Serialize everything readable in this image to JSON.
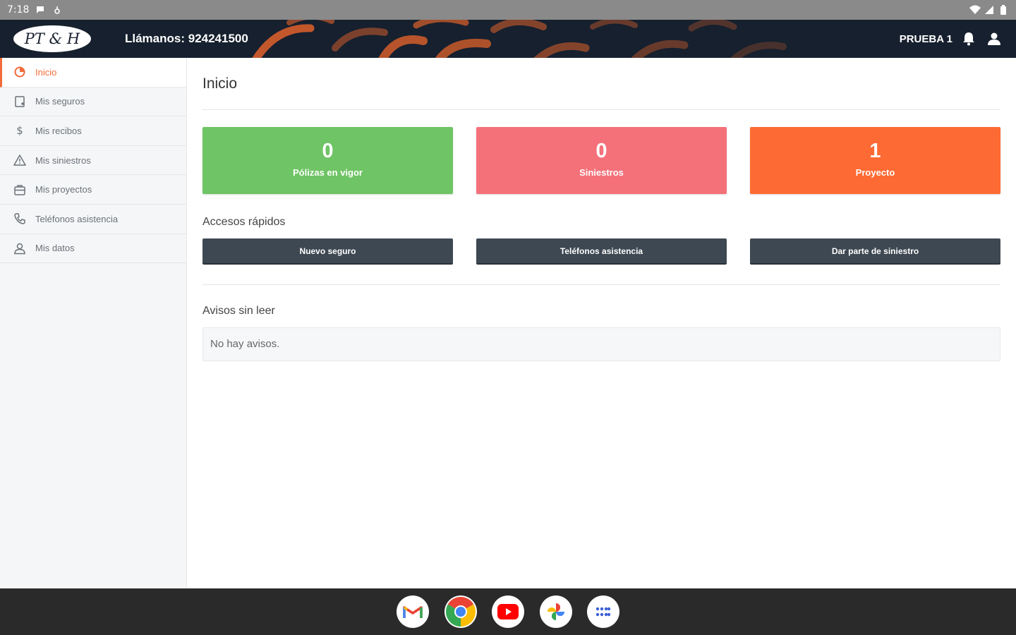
{
  "status_bar": {
    "time": "7:18"
  },
  "header": {
    "logo_text": "PT & H",
    "phone": "Llámanos: 924241500",
    "username": "PRUEBA 1"
  },
  "sidebar": {
    "items": [
      {
        "label": "Inicio",
        "icon": "home-icon",
        "active": true
      },
      {
        "label": "Mis seguros",
        "icon": "document-icon"
      },
      {
        "label": "Mis recibos",
        "icon": "dollar-icon"
      },
      {
        "label": "Mis siniestros",
        "icon": "warning-icon"
      },
      {
        "label": "Mis proyectos",
        "icon": "briefcase-icon"
      },
      {
        "label": "Teléfonos asistencia",
        "icon": "phone-icon"
      },
      {
        "label": "Mis datos",
        "icon": "user-icon"
      }
    ]
  },
  "main": {
    "title": "Inicio",
    "stats": [
      {
        "value": "0",
        "label": "Pólizas en vigor",
        "color": "#6fc465"
      },
      {
        "value": "0",
        "label": "Siniestros",
        "color": "#f4717a"
      },
      {
        "value": "1",
        "label": "Proyecto",
        "color": "#fe6a33"
      }
    ],
    "quick_access": {
      "title": "Accesos rápidos",
      "buttons": [
        "Nuevo seguro",
        "Teléfonos asistencia",
        "Dar parte de siniestro"
      ]
    },
    "notices": {
      "title": "Avisos sin leer",
      "empty_text": "No hay avisos."
    }
  },
  "dock": {
    "apps": [
      "gmail-icon",
      "chrome-icon",
      "youtube-icon",
      "photos-icon",
      "app-drawer-icon"
    ]
  },
  "colors": {
    "accent": "#f26b3a",
    "header_bg": "#16202e",
    "button_bg": "#3e4852"
  }
}
